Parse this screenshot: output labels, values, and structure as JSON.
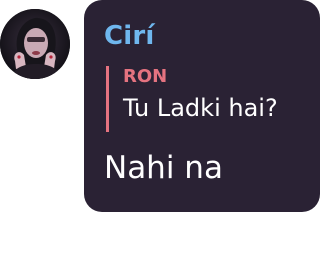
{
  "message": {
    "sender_name": "Cirí",
    "sender_color": "#6fb7ee",
    "reply": {
      "author": "RON",
      "author_color": "#e57380",
      "text": "Tu Ladki hai?"
    },
    "text": "Nahi na",
    "bubble_color": "#2a2234",
    "text_color": "#ffffff"
  },
  "avatar": {
    "icon": "profile-photo"
  }
}
